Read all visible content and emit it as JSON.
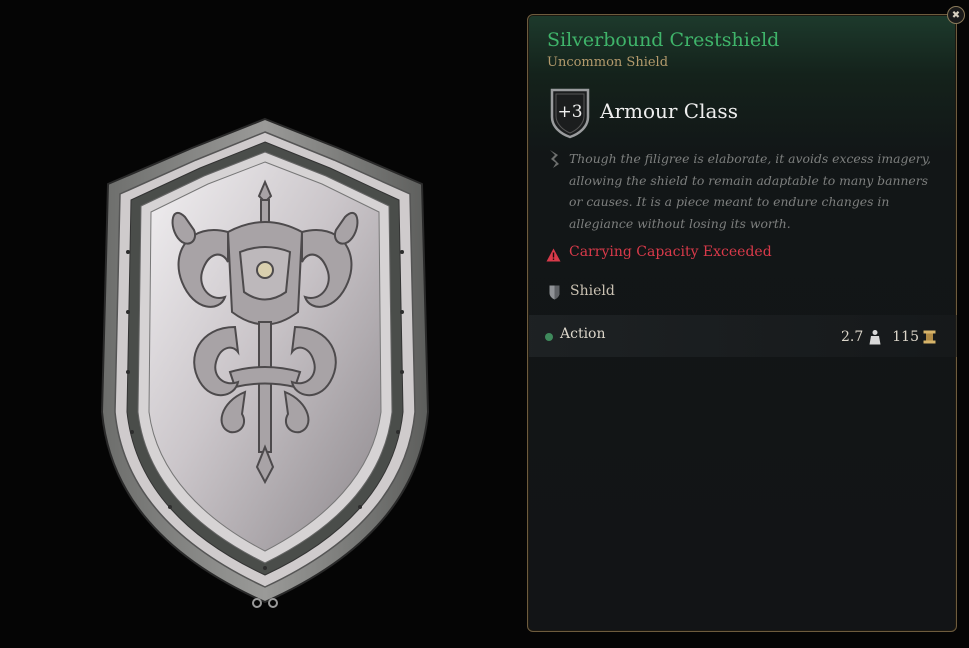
{
  "tooltip": {
    "item_name": "Silverbound Crestshield",
    "item_rarity_type": "Uncommon Shield",
    "armour_class": {
      "value": "+3",
      "label": "Armour Class"
    },
    "description": "Though the filigree is elaborate, it avoids excess imagery, allowing the shield to remain adaptable to many banners or causes. It is a piece meant to endure changes in allegiance without losing its worth.",
    "warning": "Carrying Capacity Exceeded",
    "item_type": "Shield",
    "action_label": "Action",
    "weight": "2.7",
    "price": "115"
  },
  "icons": {
    "close": "close-icon",
    "description": "quill-icon",
    "warning": "warning-triangle-icon",
    "type": "shield-icon",
    "weight": "weight-icon",
    "price": "gold-icon"
  },
  "colors": {
    "item_name": "#3fb46a",
    "rarity": "#b39a6c",
    "warning": "#d83a4a",
    "panel_border": "#6e5c3e",
    "action_dot": "#3f8a5c"
  }
}
